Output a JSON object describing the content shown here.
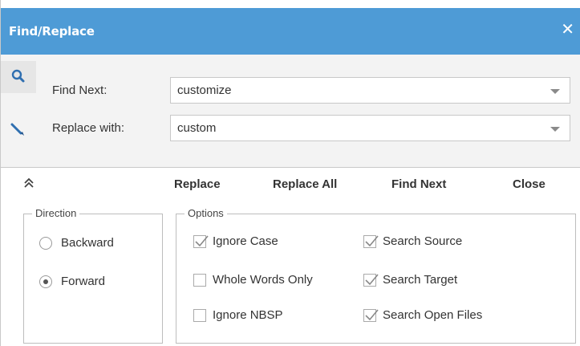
{
  "titlebar": {
    "title": "Find/Replace",
    "close_icon": "close-icon"
  },
  "find": {
    "label": "Find Next:",
    "value": "customize",
    "icon": "search-icon"
  },
  "replace": {
    "label": "Replace with:",
    "value": "custom",
    "icon": "pencil-icon"
  },
  "actions": {
    "collapse_icon": "double-chevron-up-icon",
    "replace": "Replace",
    "replace_all": "Replace All",
    "find_next": "Find Next",
    "close": "Close"
  },
  "direction": {
    "legend": "Direction",
    "backward": {
      "label": "Backward",
      "selected": false
    },
    "forward": {
      "label": "Forward",
      "selected": true
    }
  },
  "options": {
    "legend": "Options",
    "ignore_case": {
      "label": "Ignore Case",
      "checked": true
    },
    "whole_words": {
      "label": "Whole Words Only",
      "checked": false
    },
    "ignore_nbsp": {
      "label": "Ignore NBSP",
      "checked": false
    },
    "search_source": {
      "label": "Search Source",
      "checked": true
    },
    "search_target": {
      "label": "Search Target",
      "checked": true
    },
    "search_open_files": {
      "label": "Search Open Files",
      "checked": true
    }
  },
  "colors": {
    "titlebar": "#4e9bd6",
    "icon_blue": "#2f6fb0"
  }
}
